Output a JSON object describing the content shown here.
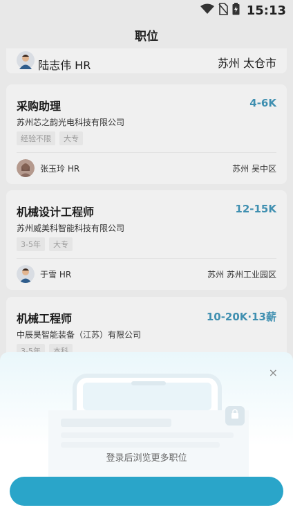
{
  "status_bar": {
    "time": "15:13"
  },
  "header": {
    "title": "职位"
  },
  "jobs": [
    {
      "hr": "陆志伟 HR",
      "location": "苏州  太仓市"
    },
    {
      "title": "采购助理",
      "salary": "4-6K",
      "company": "苏州芯之韵光电科技有限公司",
      "tags": [
        "经验不限",
        "大专"
      ],
      "hr": "张玉玲 HR",
      "location": "苏州  吴中区"
    },
    {
      "title": "机械设计工程师",
      "salary": "12-15K",
      "company": "苏州威美科智能科技有限公司",
      "tags": [
        "3-5年",
        "大专"
      ],
      "hr": "于雪 HR",
      "location": "苏州  苏州工业园区"
    },
    {
      "title": "机械工程师",
      "salary": "10-20K·13薪",
      "company": "中辰昊智能装备（江苏）有限公司",
      "tags": [
        "3-5年",
        "本科"
      ]
    }
  ],
  "login_sheet": {
    "close": "×",
    "message": "登录后浏览更多职位",
    "button_label": ""
  },
  "colors": {
    "accent": "#2aa5c9",
    "salary": "#3f8fb0"
  }
}
